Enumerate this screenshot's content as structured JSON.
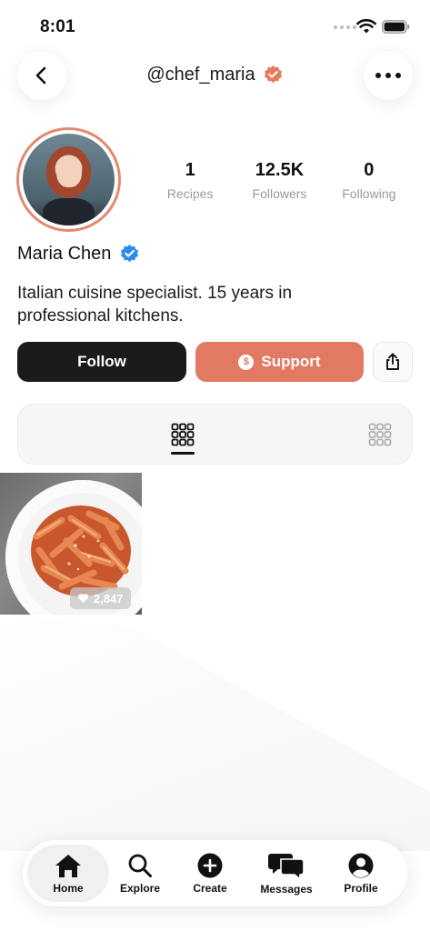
{
  "status_bar": {
    "time": "8:01"
  },
  "header": {
    "handle": "@chef_maria"
  },
  "profile": {
    "name": "Maria Chen",
    "bio": "Italian cuisine specialist. 15 years in professional kitchens.",
    "stats": [
      {
        "value": "1",
        "label": "Recipes"
      },
      {
        "value": "12.5K",
        "label": "Followers"
      },
      {
        "value": "0",
        "label": "Following"
      }
    ]
  },
  "actions": {
    "follow_label": "Follow",
    "support_label": "Support",
    "support_icon_glyph": "$"
  },
  "posts": [
    {
      "likes": "2,847"
    }
  ],
  "bottom_nav": {
    "items": [
      {
        "label": "Home"
      },
      {
        "label": "Explore"
      },
      {
        "label": "Create"
      },
      {
        "label": "Messages"
      },
      {
        "label": "Profile"
      }
    ]
  },
  "colors": {
    "accent": "#e27a63",
    "verified_orange": "#e8795d",
    "verified_blue": "#2d8cf0",
    "dark": "#1b1b1b"
  }
}
